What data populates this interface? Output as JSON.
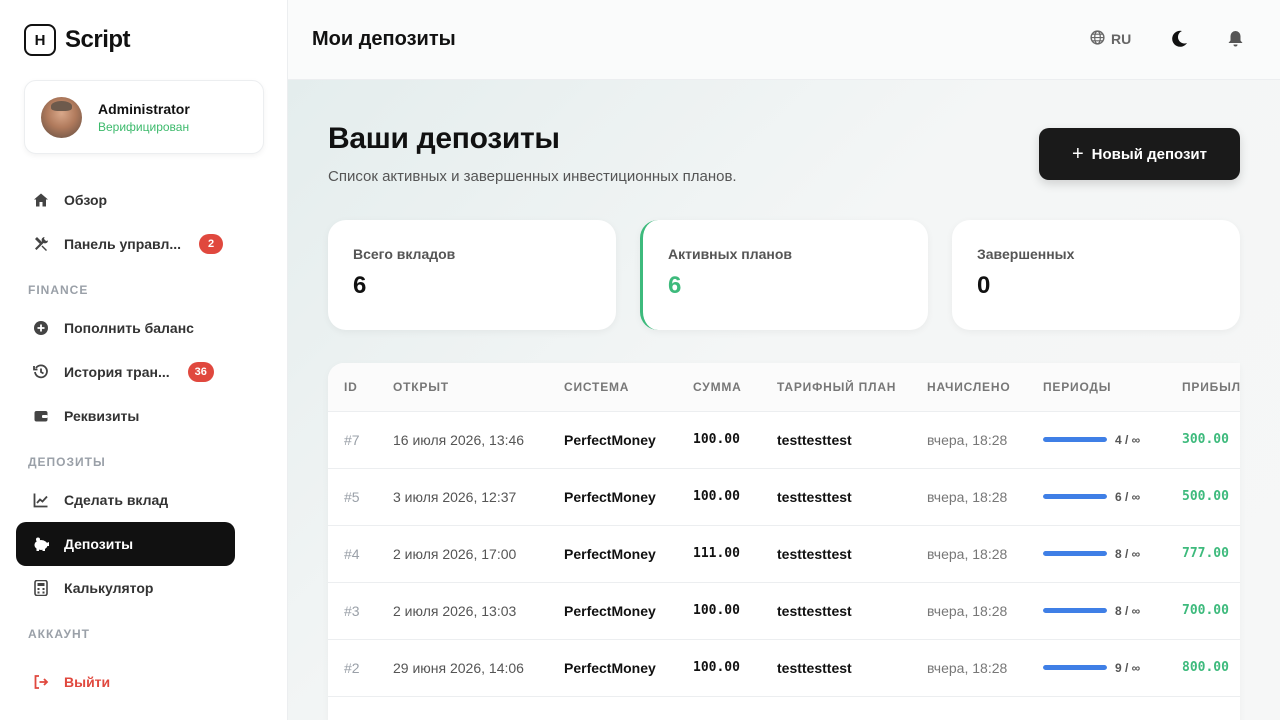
{
  "brand": {
    "logo_letter": "H",
    "name": "Script"
  },
  "user": {
    "name": "Administrator",
    "status": "Верифицирован"
  },
  "nav": {
    "overview": "Обзор",
    "panel": "Панель управл...",
    "panel_badge": "2",
    "section_finance": "FINANCE",
    "topup": "Пополнить баланс",
    "history": "История тран...",
    "history_badge": "36",
    "requisites": "Реквизиты",
    "section_deposits": "ДЕПОЗИТЫ",
    "make_deposit": "Сделать вклад",
    "deposits": "Депозиты",
    "calculator": "Калькулятор",
    "section_account": "АККАУНТ",
    "logout": "Выйти"
  },
  "topbar": {
    "title": "Мои депозиты",
    "lang": "RU"
  },
  "main": {
    "heading": "Ваши депозиты",
    "subtitle": "Список активных и завершенных инвестиционных планов.",
    "new_button": "Новый депозит"
  },
  "stats": {
    "total": {
      "label": "Всего вкладов",
      "value": "6"
    },
    "active": {
      "label": "Активных планов",
      "value": "6"
    },
    "done": {
      "label": "Завершенных",
      "value": "0"
    }
  },
  "table": {
    "headers": {
      "id": "ID",
      "opened": "ОТКРЫТ",
      "system": "СИСТЕМА",
      "sum": "СУММА",
      "plan": "ТАРИФНЫЙ ПЛАН",
      "accrued": "НАЧИСЛЕНО",
      "periods": "ПЕРИОДЫ",
      "profit": "ПРИБЫЛЬ"
    },
    "rows": [
      {
        "id": "#7",
        "opened": "16 июля 2026, 13:46",
        "system": "PerfectMoney",
        "sum": "100.00",
        "plan": "testtesttest",
        "accrued": "вчера, 18:28",
        "periods": "4 / ∞",
        "progress": 1.0,
        "profit": "300.00"
      },
      {
        "id": "#5",
        "opened": "3 июля 2026, 12:37",
        "system": "PerfectMoney",
        "sum": "100.00",
        "plan": "testtesttest",
        "accrued": "вчера, 18:28",
        "periods": "6 / ∞",
        "progress": 1.0,
        "profit": "500.00"
      },
      {
        "id": "#4",
        "opened": "2 июля 2026, 17:00",
        "system": "PerfectMoney",
        "sum": "111.00",
        "plan": "testtesttest",
        "accrued": "вчера, 18:28",
        "periods": "8 / ∞",
        "progress": 1.0,
        "profit": "777.00"
      },
      {
        "id": "#3",
        "opened": "2 июля 2026, 13:03",
        "system": "PerfectMoney",
        "sum": "100.00",
        "plan": "testtesttest",
        "accrued": "вчера, 18:28",
        "periods": "8 / ∞",
        "progress": 1.0,
        "profit": "700.00"
      },
      {
        "id": "#2",
        "opened": "29 июня 2026, 14:06",
        "system": "PerfectMoney",
        "sum": "100.00",
        "plan": "testtesttest",
        "accrued": "вчера, 18:28",
        "periods": "9 / ∞",
        "progress": 1.0,
        "profit": "800.00"
      }
    ]
  },
  "colors": {
    "accent_green": "#3dba7c",
    "danger": "#e0483e",
    "progress_blue": "#3f7fe6",
    "dark": "#1a1a1a"
  }
}
